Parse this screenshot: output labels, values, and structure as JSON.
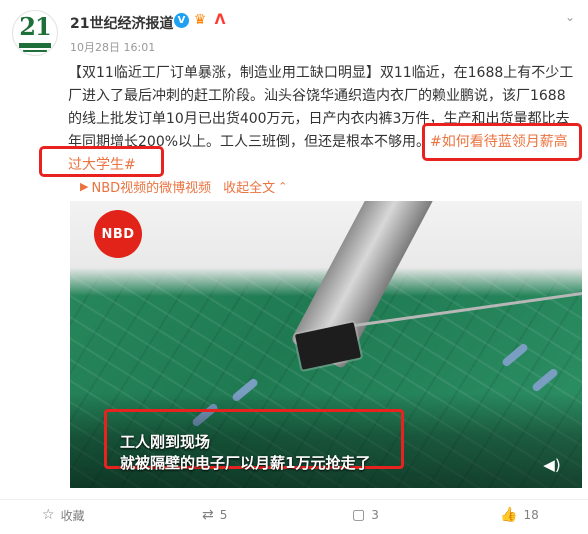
{
  "post": {
    "author": "21世纪经济报道",
    "time": "10月28日 16:01",
    "avatar_text": "21",
    "content_text": "【双11临近工厂订单暴涨，制造业用工缺口明显】双11临近，在1688上有不少工厂进入了最后冲刺的赶工阶段。汕头谷饶华通织造内衣厂的赖业鹏说，该厂1688的线上批发订单10月已出货400万元，日产内衣内裤3万件，生产和出货量都比去年同期增长200%以上。工人三班倒，但还是根本不够用。",
    "hashtag": "#如何看待蓝领月薪高过大学生#",
    "source_text": "NBD视频的微博视频",
    "collapse_text": "收起全文"
  },
  "video": {
    "logo_text": "NBD",
    "caption_line1": "工人刚到现场",
    "caption_line2": "就被隔壁的电子厂以月薪1万元抢走了"
  },
  "actions": {
    "favorite_label": "收藏",
    "repost_count": "5",
    "comment_count": "3",
    "like_count": "18"
  },
  "colors": {
    "accent_orange": "#eb7340",
    "highlight_red": "#e8231f",
    "verified_blue": "#1da1f2"
  },
  "icons": [
    "avatar-logo",
    "verified-icon",
    "crown-icon",
    "a-badge-icon",
    "chevron-down-icon",
    "video-source-icon",
    "collapse-icon",
    "volume-icon",
    "favorite-icon",
    "repost-icon",
    "comment-icon",
    "like-icon"
  ]
}
